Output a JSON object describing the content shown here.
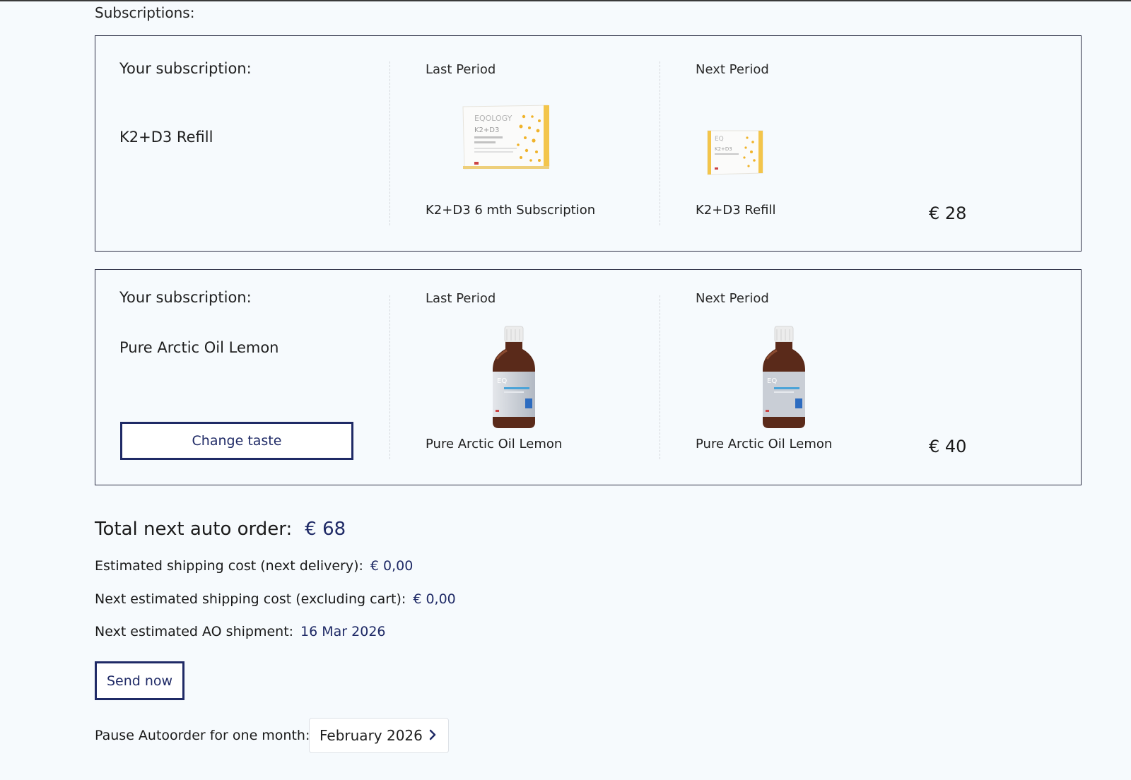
{
  "section_title": "Subscriptions:",
  "subscriptions": [
    {
      "label": "Your subscription:",
      "product": "K2+D3 Refill",
      "last_period": {
        "heading": "Last Period",
        "name": "K2+D3 6 mth Subscription",
        "image": "k2d3-box-image"
      },
      "next_period": {
        "heading": "Next Period",
        "name": "K2+D3 Refill",
        "image": "k2d3-refill-box-image"
      },
      "price": "€ 28"
    },
    {
      "label": "Your subscription:",
      "product": "Pure Arctic Oil Lemon",
      "change_button": "Change taste",
      "last_period": {
        "heading": "Last Period",
        "name": "Pure Arctic Oil Lemon",
        "image": "arctic-oil-bottle-image"
      },
      "next_period": {
        "heading": "Next Period",
        "name": "Pure Arctic Oil Lemon",
        "image": "arctic-oil-bottle-image"
      },
      "price": "€ 40"
    }
  ],
  "summary": {
    "total_label": "Total next auto order:",
    "total_value": "€ 68",
    "shipping_label": "Estimated shipping cost (next delivery):",
    "shipping_value": "€ 0,00",
    "next_shipping_label": "Next estimated shipping cost (excluding cart):",
    "next_shipping_value": "€ 0,00",
    "shipment_label": "Next estimated AO shipment:",
    "shipment_value": "16 Mar 2026",
    "send_now": "Send now",
    "pause_label": "Pause Autoorder for one month:",
    "pause_month": "February 2026"
  },
  "colors": {
    "accent": "#1f2a66",
    "background": "#f6fafd",
    "border": "#2c2f45"
  }
}
